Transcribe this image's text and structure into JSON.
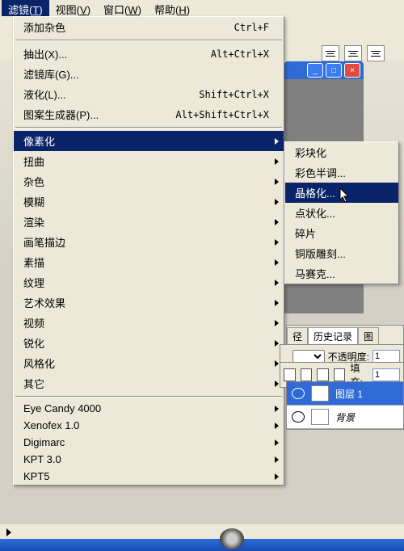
{
  "menubar": {
    "filter": {
      "label": "滤镜",
      "key": "T"
    },
    "view": {
      "label": "视图",
      "key": "V"
    },
    "window": {
      "label": "窗口",
      "key": "W"
    },
    "help": {
      "label": "帮助",
      "key": "H"
    }
  },
  "main_menu": {
    "addnoise": {
      "label": "添加杂色",
      "shortcut": "Ctrl+F"
    },
    "extract": {
      "label": "抽出(X)...",
      "shortcut": "Alt+Ctrl+X"
    },
    "filter_gallery": {
      "label": "滤镜库(G)...",
      "shortcut": ""
    },
    "liquify": {
      "label": "液化(L)...",
      "shortcut": "Shift+Ctrl+X"
    },
    "patternmaker": {
      "label": "图案生成器(P)...",
      "shortcut": "Alt+Shift+Ctrl+X"
    },
    "pixelate": {
      "label": "像素化"
    },
    "distort": {
      "label": "扭曲"
    },
    "noise": {
      "label": "杂色"
    },
    "blur": {
      "label": "模糊"
    },
    "render": {
      "label": "渲染"
    },
    "brushstrokes": {
      "label": "画笔描边"
    },
    "sketch": {
      "label": "素描"
    },
    "texture": {
      "label": "纹理"
    },
    "artistic": {
      "label": "艺术效果"
    },
    "video": {
      "label": "视频"
    },
    "sharpen": {
      "label": "锐化"
    },
    "stylize": {
      "label": "风格化"
    },
    "other": {
      "label": "其它"
    },
    "eyecandy": {
      "label": "Eye Candy 4000"
    },
    "xenofex": {
      "label": "Xenofex 1.0"
    },
    "digimarc": {
      "label": "Digimarc"
    },
    "kpt3": {
      "label": "KPT 3.0"
    },
    "kpt5": {
      "label": "KPT5"
    }
  },
  "sub_menu": {
    "facet": {
      "label": "彩块化"
    },
    "halftone": {
      "label": "彩色半调..."
    },
    "crystallize": {
      "label": "晶格化..."
    },
    "pointillize": {
      "label": "点状化..."
    },
    "fragment": {
      "label": "碎片"
    },
    "mezzotint": {
      "label": "铜版雕刻..."
    },
    "mosaic": {
      "label": "马赛克..."
    }
  },
  "panels": {
    "tab_path": "径",
    "tab_history": "历史记录",
    "tab_extra": "图",
    "opacity_label": "不透明度:",
    "opacity_value": "1",
    "fill_label": "填充:",
    "fill_value": "1",
    "layer1": "图层 1",
    "background": "背景"
  }
}
